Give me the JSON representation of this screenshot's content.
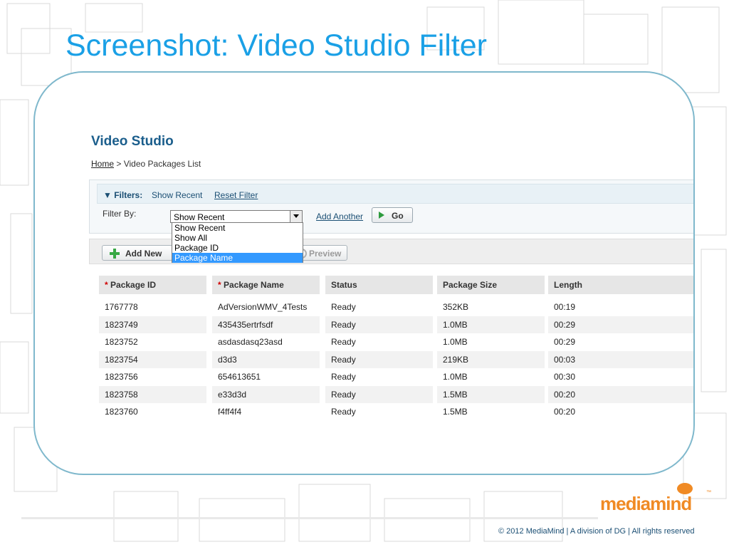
{
  "slide": {
    "title": "Screenshot: Video Studio Filter",
    "copyright": "© 2012 MediaMind | A division of DG | All rights reserved",
    "logo_text": "mediamind",
    "logo_tm": "™"
  },
  "app": {
    "title": "Video Studio",
    "breadcrumb": {
      "home": "Home",
      "separator": " > ",
      "current": "Video Packages List"
    }
  },
  "filters": {
    "label": "▼ Filters:",
    "show_recent": "Show Recent",
    "reset_filter": "Reset Filter",
    "filter_by_label": "Filter By:",
    "select_value": "Show Recent",
    "options": [
      "Show Recent",
      "Show All",
      "Package ID",
      "Package Name"
    ],
    "highlighted_option": "Package Name",
    "add_another": "Add Another",
    "go_label": "Go"
  },
  "toolbar": {
    "add_new": "Add New",
    "preview": "Preview"
  },
  "table": {
    "required_marker": "*",
    "columns": [
      "Package ID",
      "Package Name",
      "Status",
      "Package Size",
      "Length"
    ],
    "required_columns": [
      true,
      true,
      false,
      false,
      false
    ],
    "rows": [
      [
        "1767778",
        "AdVersionWMV_4Tests",
        "Ready",
        "352KB",
        "00:19"
      ],
      [
        "1823749",
        "435435ertrfsdf",
        "Ready",
        "1.0MB",
        "00:29"
      ],
      [
        "1823752",
        "asdasdasq23asd",
        "Ready",
        "1.0MB",
        "00:29"
      ],
      [
        "1823754",
        "d3d3",
        "Ready",
        "219KB",
        "00:03"
      ],
      [
        "1823756",
        "654613651",
        "Ready",
        "1.0MB",
        "00:30"
      ],
      [
        "1823758",
        "e33d3d",
        "Ready",
        "1.5MB",
        "00:20"
      ],
      [
        "1823760",
        "f4ff4f4",
        "Ready",
        "1.5MB",
        "00:20"
      ]
    ]
  },
  "colors": {
    "title_blue": "#1aa0e6",
    "frame_border": "#7fb8cc",
    "app_title": "#1b5e8c",
    "logo_orange": "#f08a24",
    "selection_blue": "#3399ff"
  }
}
